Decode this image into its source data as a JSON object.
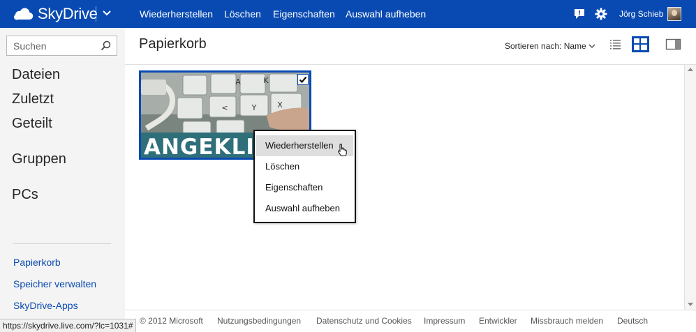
{
  "colors": {
    "brand": "#094ab2",
    "sidebar_bg": "#f4f4f4",
    "menu_hover": "#dedede",
    "link": "#094ab2"
  },
  "topbar": {
    "app_name": "SkyDrive",
    "brand_icon": "cloud-icon",
    "commands": [
      {
        "label": "Wiederherstellen"
      },
      {
        "label": "Löschen"
      },
      {
        "label": "Eigenschaften"
      },
      {
        "label": "Auswahl aufheben"
      }
    ],
    "icons": [
      "feedback-icon",
      "gear-icon"
    ],
    "username": "Jörg Schieb"
  },
  "sidebar": {
    "search_placeholder": "Suchen",
    "main_nav": [
      {
        "label": "Dateien"
      },
      {
        "label": "Zuletzt"
      },
      {
        "label": "Geteilt"
      },
      {
        "label": "Gruppen"
      },
      {
        "label": "PCs"
      }
    ],
    "links": [
      {
        "label": "Papierkorb"
      },
      {
        "label": "Speicher verwalten"
      },
      {
        "label": "SkyDrive-Apps"
      }
    ]
  },
  "main": {
    "title": "Papierkorb",
    "sort_label": "Sortieren nach: Name",
    "view_icons": [
      "list-view-icon",
      "tile-view-icon",
      "details-pane-icon"
    ],
    "tile": {
      "banner_text": "ANGEKLI",
      "keys": [
        "A",
        "K",
        "<",
        "Y",
        "X"
      ],
      "selected": true
    }
  },
  "context_menu": {
    "items": [
      {
        "label": "Wiederherstellen"
      },
      {
        "label": "Löschen"
      },
      {
        "label": "Eigenschaften"
      },
      {
        "label": "Auswahl aufheben"
      }
    ]
  },
  "footer": {
    "copyright": "© 2012 Microsoft",
    "links": [
      {
        "label": "Nutzungsbedingungen"
      },
      {
        "label": "Datenschutz und Cookies"
      },
      {
        "label": "Impressum"
      },
      {
        "label": "Entwickler"
      },
      {
        "label": "Missbrauch melden"
      },
      {
        "label": "Deutsch"
      }
    ]
  },
  "status_url": "https://skydrive.live.com/?lc=1031#"
}
